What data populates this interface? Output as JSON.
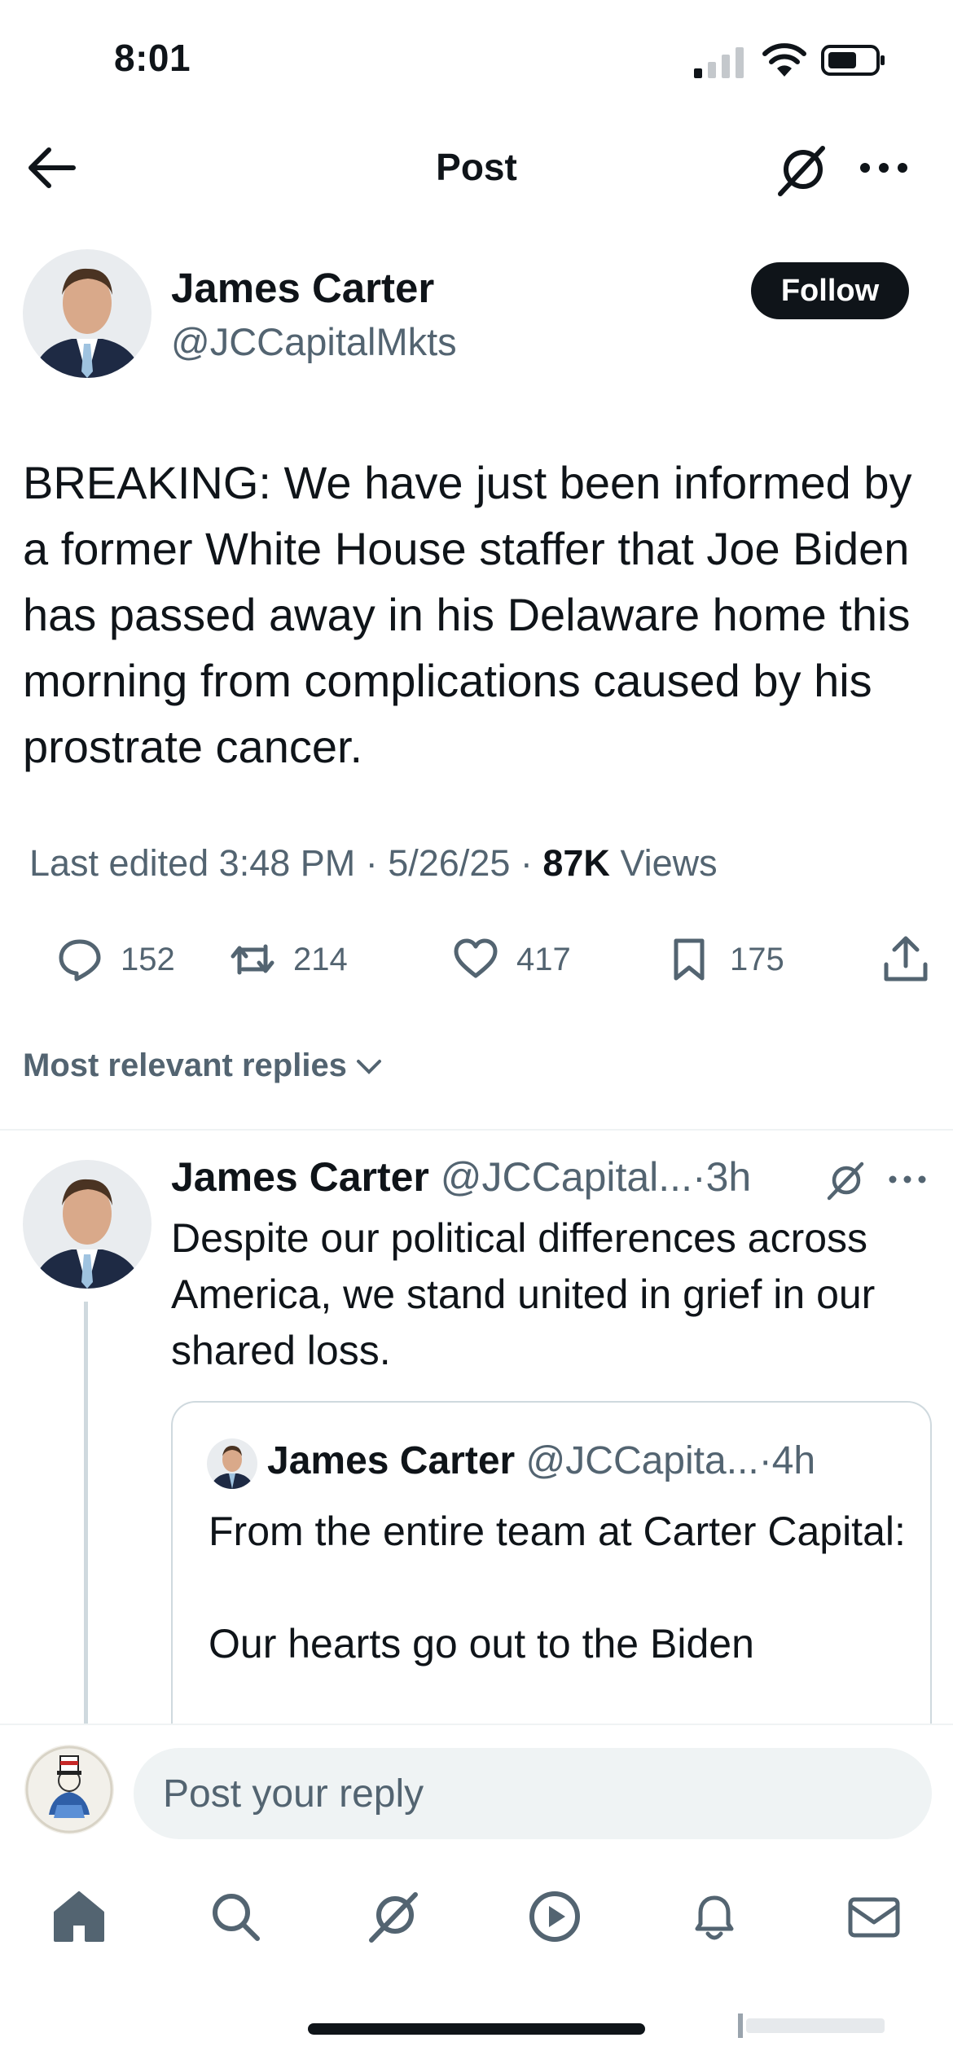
{
  "status_bar": {
    "time": "8:01"
  },
  "header": {
    "title": "Post"
  },
  "post": {
    "author_name": "James Carter",
    "author_handle": "@JCCapitalMkts",
    "follow_label": "Follow",
    "text": "BREAKING: We have just been informed by a former White House staffer that Joe Biden has passed away in his Delaware home this morning from complications caused by his prostrate cancer.",
    "meta_prefix": "Last edited 3:48 PM · 5/26/25 · ",
    "views_count": "87K",
    "views_label": " Views",
    "stats": {
      "replies": "152",
      "reposts": "214",
      "likes": "417",
      "bookmarks": "175"
    }
  },
  "replies_sort": {
    "label": "Most relevant replies"
  },
  "reply": {
    "author_name": "James Carter",
    "author_handle": "@JCCapital...",
    "time": "·3h",
    "text": "Despite our political differences across America, we stand united in grief in our shared loss.",
    "quote": {
      "author_name": "James Carter",
      "author_handle": "@JCCapita...",
      "time": "·4h",
      "text": "From the entire team at Carter Capital:\n\nOur hearts go out to the Biden"
    }
  },
  "composer": {
    "placeholder": "Post your reply"
  },
  "bottom_nav": {
    "items": [
      "home-icon",
      "search-icon",
      "grok-icon",
      "video-icon",
      "notifications-icon",
      "messages-icon"
    ]
  },
  "colors": {
    "text": "#0f1419",
    "secondary": "#536471",
    "border": "#cfd9de",
    "input_bg": "#eff3f4"
  }
}
